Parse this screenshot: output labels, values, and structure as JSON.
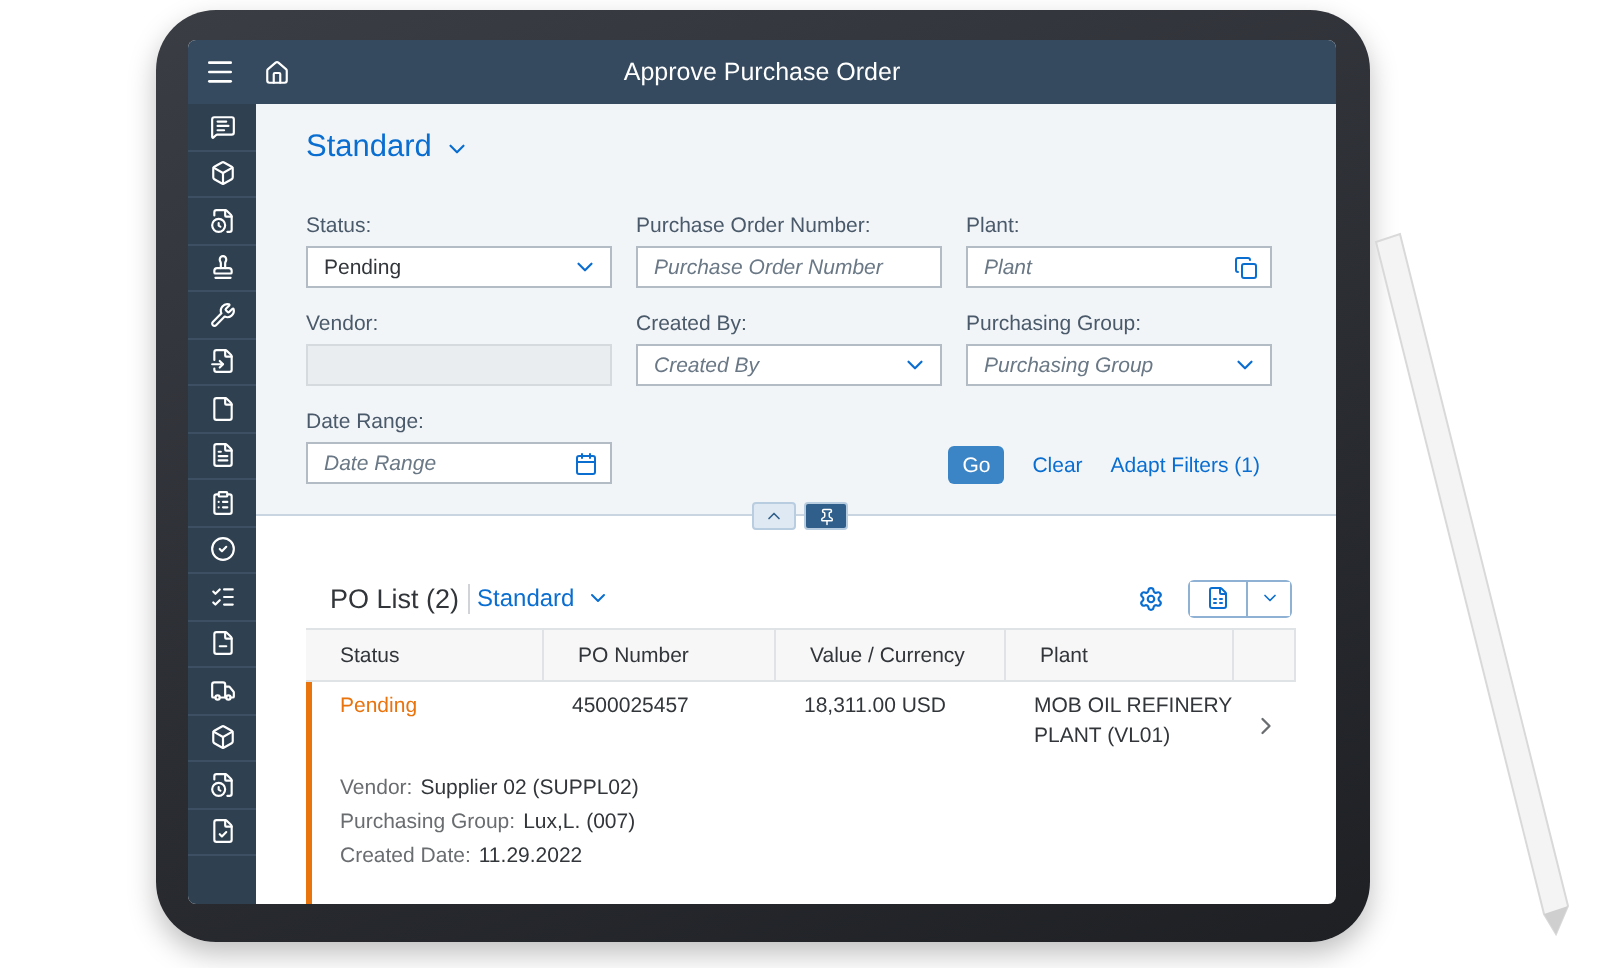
{
  "app_bar": {
    "title": "Approve Purchase Order"
  },
  "variant": {
    "label": "Standard"
  },
  "filters": [
    {
      "label": "Status:",
      "kind": "select",
      "value": "Pending"
    },
    {
      "label": "Purchase Order Number:",
      "kind": "input",
      "placeholder": "Purchase Order Number"
    },
    {
      "label": "Plant:",
      "kind": "value_help",
      "placeholder": "Plant"
    },
    {
      "label": "Vendor:",
      "kind": "disabled"
    },
    {
      "label": "Created By:",
      "kind": "select",
      "placeholder": "Created By"
    },
    {
      "label": "Purchasing Group:",
      "kind": "select",
      "placeholder": "Purchasing Group"
    },
    {
      "label": "Date Range:",
      "kind": "date",
      "placeholder": "Date Range"
    }
  ],
  "filter_actions": {
    "go": "Go",
    "clear": "Clear",
    "adapt": "Adapt Filters (1)"
  },
  "list": {
    "title": "PO List (2)",
    "variant": "Standard",
    "columns": [
      "Status",
      "PO Number",
      "Value / Currency",
      "Plant"
    ],
    "rows": [
      {
        "status": "Pending",
        "color": "#e9730c",
        "po_number": "4500025457",
        "value": "18,311.00 USD",
        "plant": "MOB OIL REFINERY PLANT (VL01)",
        "details": [
          {
            "label": "Vendor:",
            "value": "Supplier 02 (SUPPL02)"
          },
          {
            "label": "Purchasing Group:",
            "value": "Lux,L. (007)"
          },
          {
            "label": "Created Date:",
            "value": "11.29.2022"
          }
        ]
      }
    ]
  }
}
